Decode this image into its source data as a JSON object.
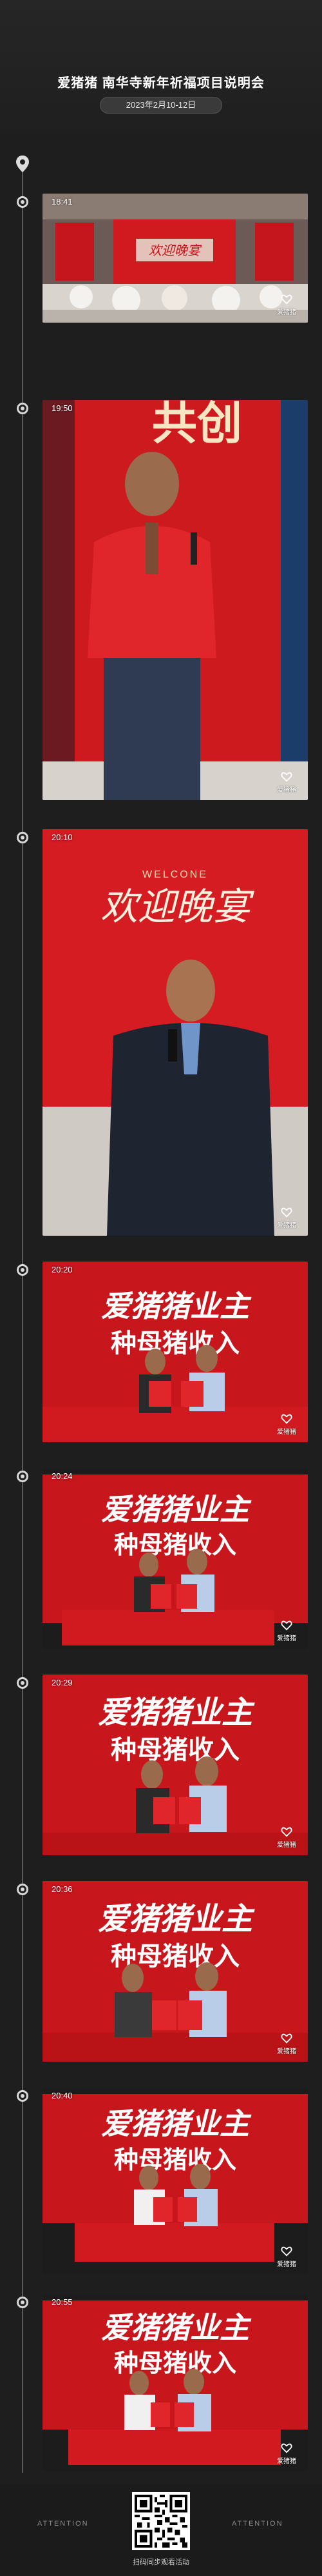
{
  "header": {
    "title": "爱猪猪 南华寺新年祈福项目说明会",
    "date": "2023年2月10-12日"
  },
  "watermark_label": "爱猪猪",
  "entries": [
    {
      "time": "18:41",
      "scene": "banquet-hall"
    },
    {
      "time": "19:50",
      "scene": "speaker-red-jacket"
    },
    {
      "time": "20:10",
      "scene": "speaker-suit"
    },
    {
      "time": "20:20",
      "scene": "signing"
    },
    {
      "time": "20:24",
      "scene": "signing"
    },
    {
      "time": "20:29",
      "scene": "signing"
    },
    {
      "time": "20:36",
      "scene": "signing"
    },
    {
      "time": "20:40",
      "scene": "signing"
    },
    {
      "time": "20:55",
      "scene": "signing"
    }
  ],
  "backdrop_text": {
    "welcome_en": "WELCONE",
    "welcome_cn": "欢迎晚宴",
    "banner_line1": "爱猪猪业主",
    "banner_line2": "种母猪收入",
    "banner_big": "共创"
  },
  "footer": {
    "attention_left": "ATTENTION",
    "attention_right": "ATTENTION",
    "qr_caption": "扫码同步观看活动"
  },
  "colors": {
    "background": "#1e1e1e",
    "stage_red": "#c8161d",
    "timeline": "#5a5a5a"
  }
}
